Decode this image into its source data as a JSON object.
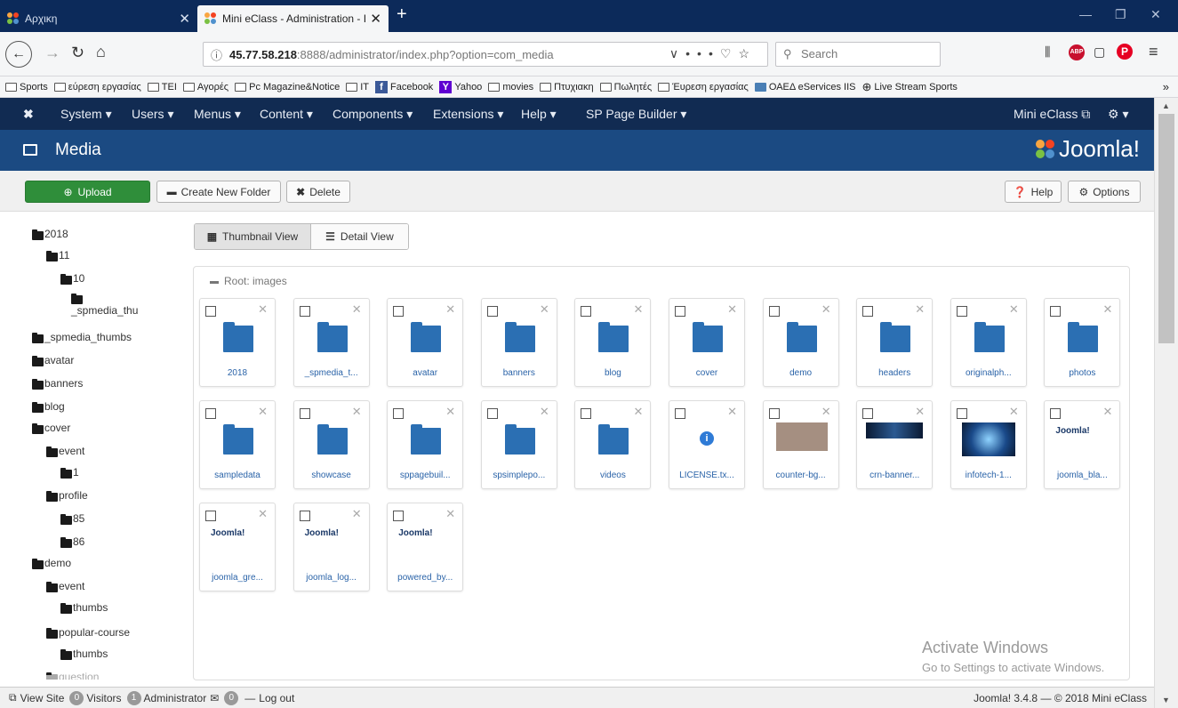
{
  "browser": {
    "tabs": [
      {
        "title": "Αρχικη"
      },
      {
        "title": "Mini eClass - Administration - I"
      }
    ],
    "url_host": "45.77.58.218",
    "url_rest": ":8888/administrator/index.php?option=com_media",
    "url_dots": "•••",
    "search_placeholder": "Search"
  },
  "bookmarks": [
    "Sports",
    "εύρεση εργασίας",
    "TEI",
    "Αγορές",
    "Pc Magazine&Notice",
    "IT",
    "Facebook",
    "Yahoo",
    "movies",
    "Πτυχιακη",
    "Πωλητές",
    "Έυρεση εργασίας",
    "ΟΑΕΔ eServices IIS",
    "Live Stream Sports"
  ],
  "joomla_nav": {
    "items": [
      "System ▾",
      "Users ▾",
      "Menus ▾",
      "Content ▾",
      "Components ▾",
      "Extensions ▾",
      "Help ▾",
      "SP Page Builder ▾"
    ],
    "site_name": "Mini eClass"
  },
  "header": {
    "title": "Media",
    "logo_text": "Joomla!"
  },
  "toolbar": {
    "upload": "Upload",
    "create_folder": "Create New Folder",
    "delete": "Delete",
    "help": "Help",
    "options": "Options"
  },
  "tree": [
    {
      "label": "2018",
      "level": 0
    },
    {
      "label": "11",
      "level": 1
    },
    {
      "label": "10",
      "level": 2
    },
    {
      "label": "_spmedia_thu",
      "level": 3
    },
    {
      "label": "_spmedia_thumbs",
      "level": 0
    },
    {
      "label": "avatar",
      "level": 0
    },
    {
      "label": "banners",
      "level": 0
    },
    {
      "label": "blog",
      "level": 0
    },
    {
      "label": "cover",
      "level": 0
    },
    {
      "label": "event",
      "level": 1
    },
    {
      "label": "1",
      "level": 2
    },
    {
      "label": "profile",
      "level": 1
    },
    {
      "label": "85",
      "level": 2
    },
    {
      "label": "86",
      "level": 2
    },
    {
      "label": "demo",
      "level": 0
    },
    {
      "label": "event",
      "level": 1
    },
    {
      "label": "thumbs",
      "level": 2
    },
    {
      "label": "popular-course",
      "level": 1
    },
    {
      "label": "thumbs",
      "level": 2
    },
    {
      "label": "question",
      "level": 1
    }
  ],
  "views": {
    "thumbnail": "Thumbnail View",
    "detail": "Detail View"
  },
  "root_label": "Root: images",
  "items": [
    {
      "label": "2018",
      "kind": "folder"
    },
    {
      "label": "_spmedia_t...",
      "kind": "folder"
    },
    {
      "label": "avatar",
      "kind": "folder"
    },
    {
      "label": "banners",
      "kind": "folder"
    },
    {
      "label": "blog",
      "kind": "folder"
    },
    {
      "label": "cover",
      "kind": "folder"
    },
    {
      "label": "demo",
      "kind": "folder"
    },
    {
      "label": "headers",
      "kind": "folder"
    },
    {
      "label": "originalph...",
      "kind": "folder"
    },
    {
      "label": "photos",
      "kind": "folder"
    },
    {
      "label": "sampledata",
      "kind": "folder"
    },
    {
      "label": "showcase",
      "kind": "folder"
    },
    {
      "label": "sppagebuil...",
      "kind": "folder"
    },
    {
      "label": "spsimplepo...",
      "kind": "folder"
    },
    {
      "label": "videos",
      "kind": "folder"
    },
    {
      "label": "LICENSE.tx...",
      "kind": "info"
    },
    {
      "label": "counter-bg...",
      "kind": "texture"
    },
    {
      "label": "crn-banner...",
      "kind": "darkbanner"
    },
    {
      "label": "infotech-1...",
      "kind": "tech"
    },
    {
      "label": "joomla_bla...",
      "kind": "joomla"
    },
    {
      "label": "joomla_gre...",
      "kind": "joomla"
    },
    {
      "label": "joomla_log...",
      "kind": "joomla"
    },
    {
      "label": "powered_by...",
      "kind": "joomla_powered"
    }
  ],
  "joomla_thumb_text": "Joomla!",
  "watermark": {
    "line1": "Activate Windows",
    "line2": "Go to Settings to activate Windows."
  },
  "statusbar": {
    "view_site": "View Site",
    "visitors_count": "0",
    "visitors": "Visitors",
    "admin_count": "1",
    "administrator": "Administrator",
    "msg_count": "0",
    "logout": "Log out",
    "version": "Joomla! 3.4.8 — © 2018 Mini eClass"
  },
  "colors": {
    "firefox_tabbar": "#0c2a5a",
    "joomla_nav": "#112b52",
    "joomla_header": "#1b4a82",
    "upload_green": "#2f8e3a",
    "folder_blue": "#2b6fb3",
    "link_blue": "#2a63a8"
  }
}
